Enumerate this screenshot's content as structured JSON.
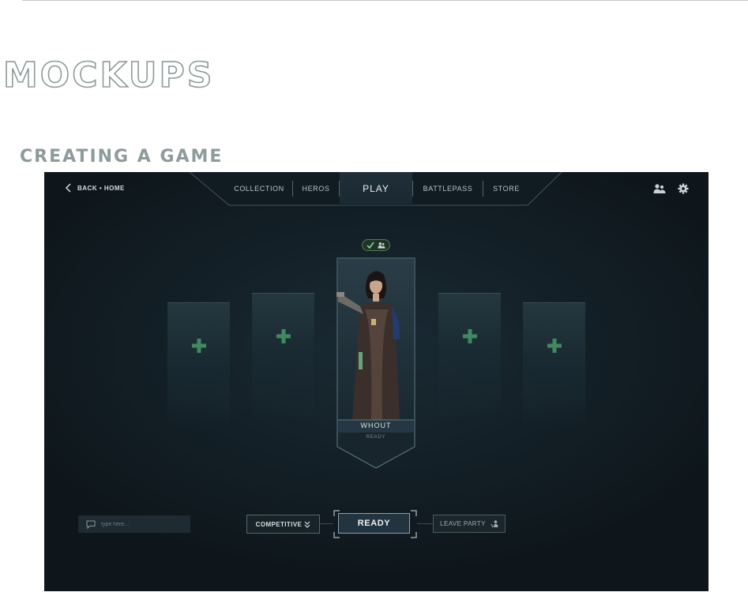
{
  "doc": {
    "title": "MOCKUPS",
    "subtitle": "CREATING A GAME"
  },
  "topbar": {
    "back_label": "BACK • HOME",
    "back_icon": "chevron-left-icon",
    "nav": [
      {
        "label": "COLLECTION",
        "active": false
      },
      {
        "label": "HEROS",
        "active": false
      },
      {
        "label": "PLAY",
        "active": true
      },
      {
        "label": "BATTLEPASS",
        "active": false
      },
      {
        "label": "STORE",
        "active": false
      }
    ],
    "icons": [
      "friends-icon",
      "gear-icon"
    ]
  },
  "party": {
    "badge_icons": [
      "checkmark-icon",
      "party-members-icon"
    ],
    "empty_slot_icon": "plus-icon",
    "hero": {
      "name": "WHOUT",
      "status": "READY"
    }
  },
  "bottom": {
    "chat_placeholder": "type here...",
    "mode_label": "COMPETITIVE",
    "ready_label": "READY",
    "leave_label": "LEAVE PARTY"
  },
  "colors": {
    "background": "#131f26",
    "accent_green": "#3f8a5e",
    "text_light": "#e8eef0",
    "doc_heading": "#8e9a9b"
  }
}
